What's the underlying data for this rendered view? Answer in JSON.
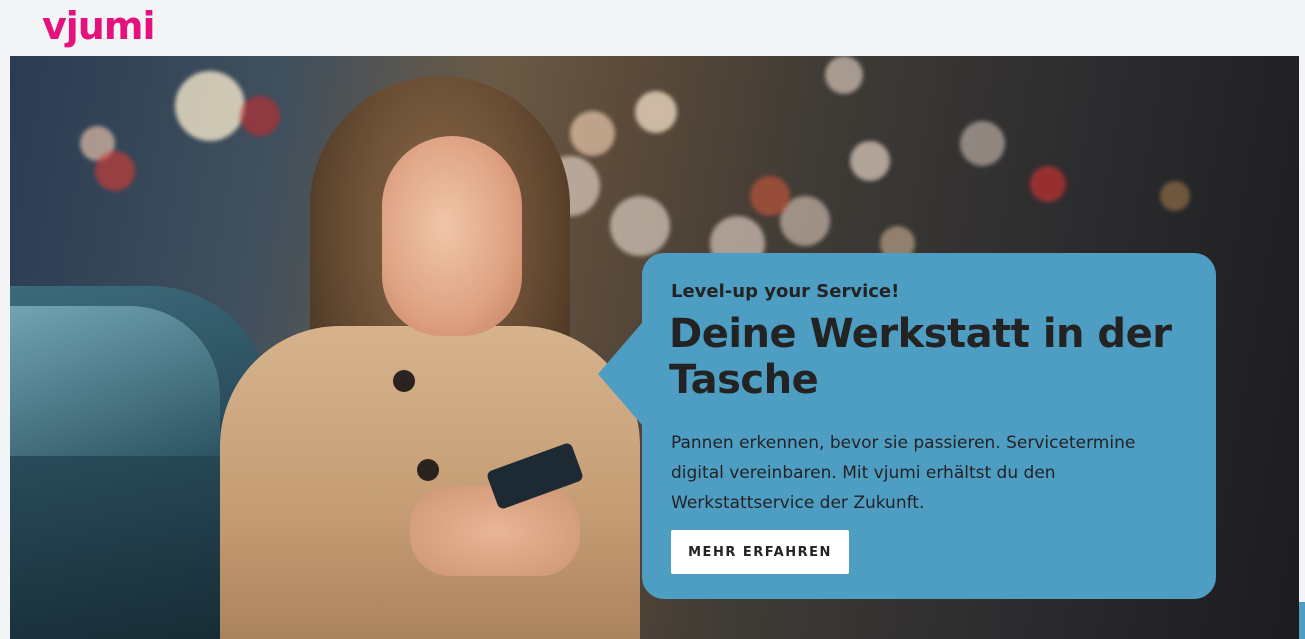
{
  "header": {
    "logo_text": "vjumi",
    "brand_color": "#e3127d"
  },
  "hero": {
    "image_alt": "photo-woman-with-smartphone",
    "card": {
      "eyebrow": "Level-up your Service!",
      "headline": "Deine Werkstatt in der Tasche",
      "body": "Pannen erkennen, bevor sie passieren. Servicetermine digital vereinbaren. Mit vjumi erhältst du den Werkstattservice der Zukunft.",
      "cta_label": "MEHR ERFAHREN",
      "card_color": "#4e9dc3",
      "text_color": "#232323"
    }
  }
}
